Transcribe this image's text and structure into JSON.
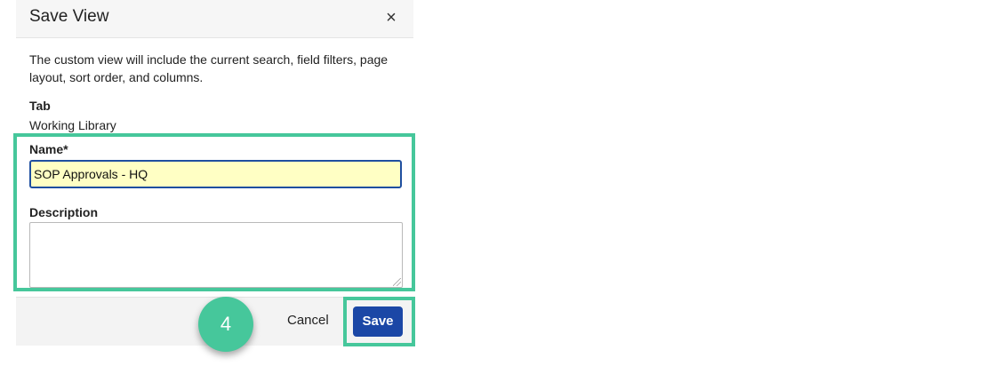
{
  "dialog": {
    "title": "Save View",
    "close_glyph": "×",
    "description_text": "The custom view will include the current search, field filters, page layout, sort order, and columns.",
    "tab_label": "Tab",
    "tab_value": "Working Library",
    "name_label": "Name*",
    "name_value": "SOP Approvals - HQ",
    "description_label": "Description",
    "description_value": "",
    "cancel_label": "Cancel",
    "save_label": "Save"
  },
  "annotation": {
    "step_number": "4",
    "highlight_color": "#46c79b"
  },
  "colors": {
    "primary_button": "#1b47a6",
    "input_focus_border": "#1f4fa0",
    "input_autofill_bg": "#ffffc4"
  }
}
